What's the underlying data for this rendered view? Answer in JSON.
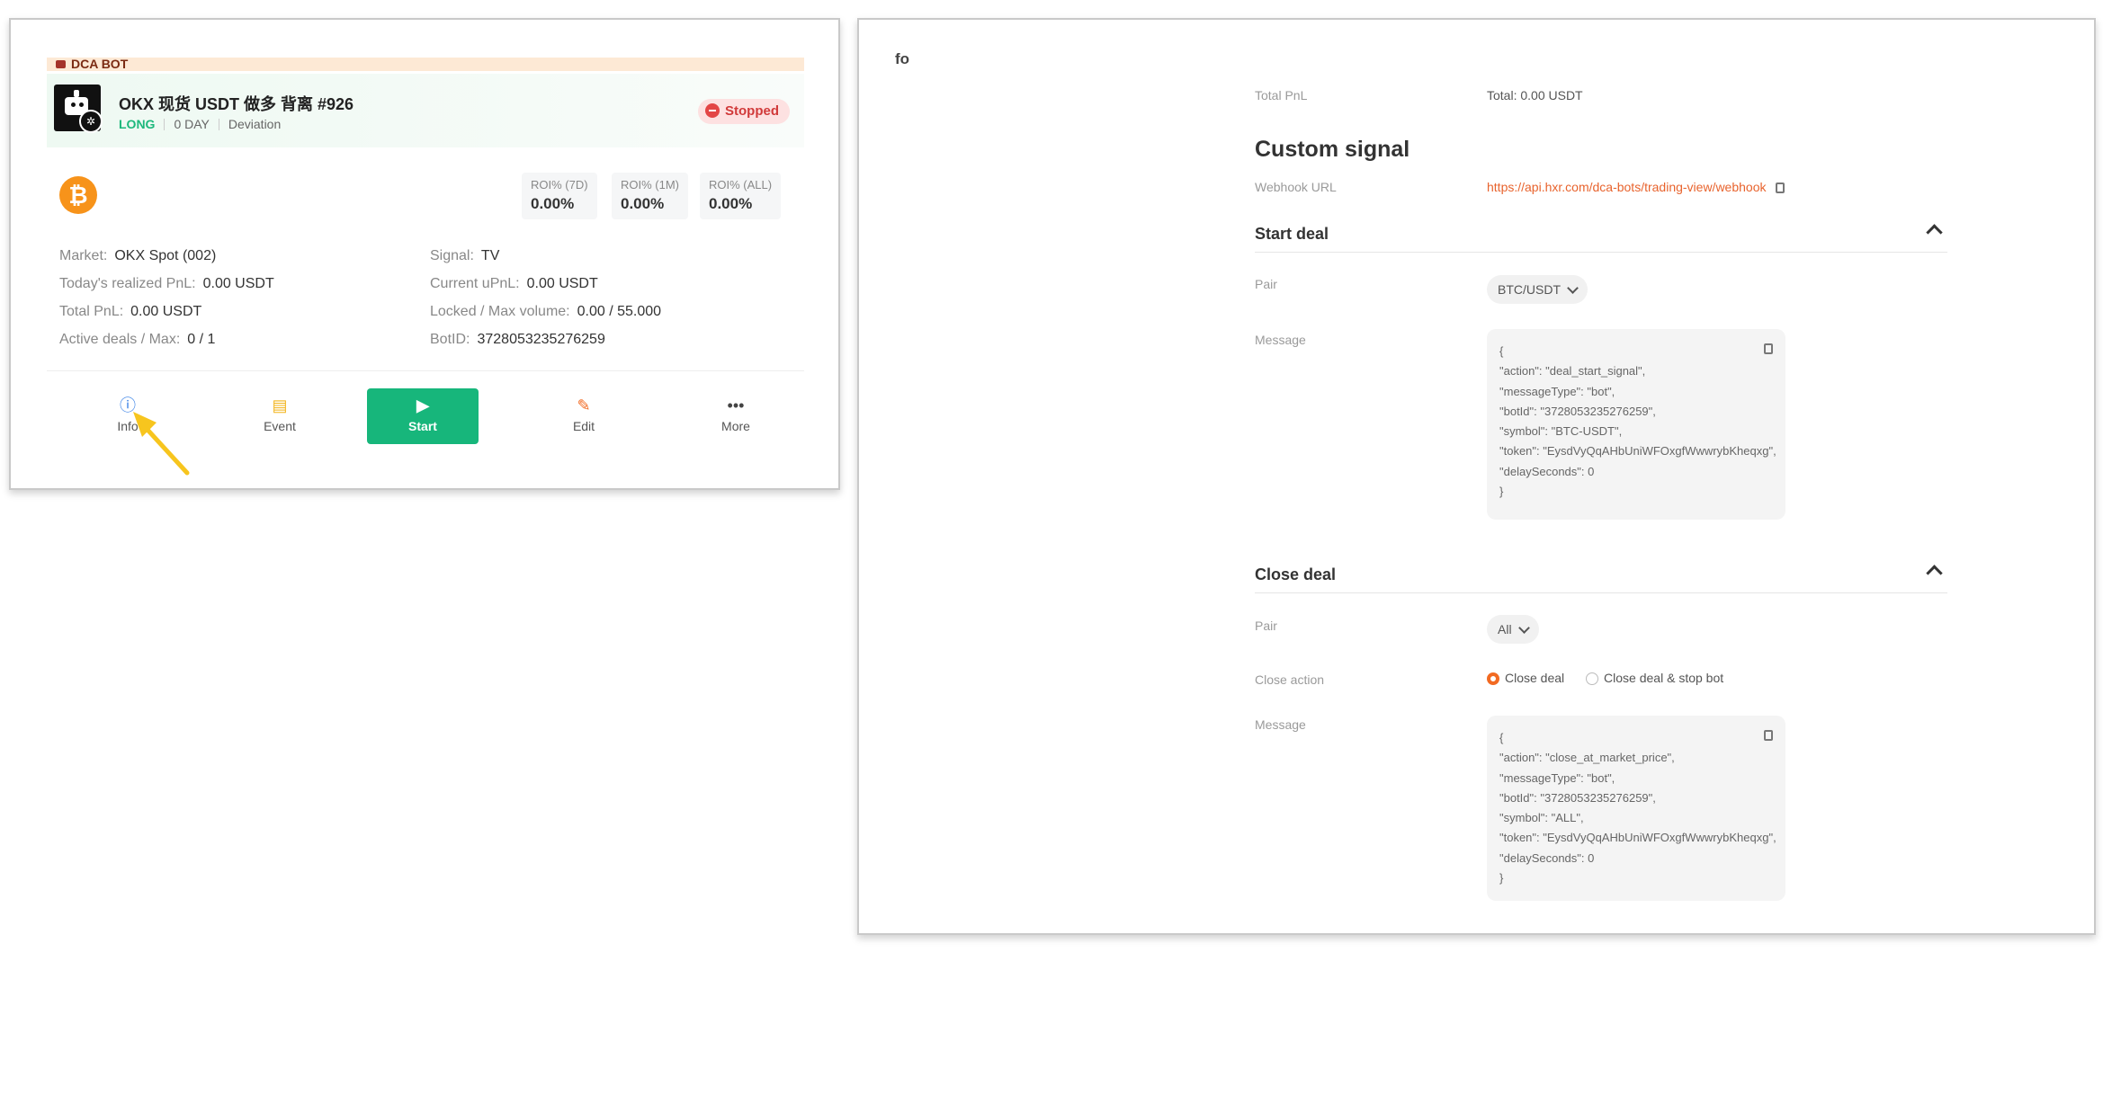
{
  "left": {
    "dca_label": "DCA BOT",
    "bot_name": "OKX 现货 USDT 做多 背离 #926",
    "tags": [
      "LONG",
      "0 DAY",
      "Deviation"
    ],
    "status": "Stopped",
    "coin_symbol": "₿",
    "roi": [
      {
        "label": "ROI% (7D)",
        "value": "0.00%"
      },
      {
        "label": "ROI% (1M)",
        "value": "0.00%"
      },
      {
        "label": "ROI% (ALL)",
        "value": "0.00%"
      }
    ],
    "info_left": [
      {
        "k": "Market:",
        "v": "OKX Spot (002)"
      },
      {
        "k": "Today's realized PnL:",
        "v": "0.00 USDT"
      },
      {
        "k": "Total PnL:",
        "v": "0.00 USDT"
      },
      {
        "k": "Active deals / Max:",
        "v": "0 / 1"
      }
    ],
    "info_right": [
      {
        "k": "Signal:",
        "v": "TV"
      },
      {
        "k": "Current uPnL:",
        "v": "0.00 USDT"
      },
      {
        "k": "Locked / Max volume:",
        "v": "0.00 / 55.000"
      },
      {
        "k": "BotID:",
        "v": "3728053235276259"
      }
    ],
    "actions": {
      "info": "Info",
      "event": "Event",
      "start": "Start",
      "edit": "Edit",
      "more": "More"
    },
    "colors": {
      "accent": "#17b67b",
      "status": "#e34646",
      "coin": "#f7931a"
    }
  },
  "right": {
    "partial_heading": "fo",
    "total_pnl_label": "Total PnL",
    "total_pnl_value": "Total: 0.00 USDT",
    "custom_signal_title": "Custom signal",
    "webhook_label": "Webhook URL",
    "webhook_url": "https://api.hxr.com/dca-bots/trading-view/webhook",
    "start_deal": {
      "title": "Start deal",
      "pair_label": "Pair",
      "pair_value": "BTC/USDT",
      "message_label": "Message",
      "message_lines": [
        "{",
        " \"action\": \"deal_start_signal\",",
        " \"messageType\": \"bot\",",
        " \"botId\": \"3728053235276259\",",
        " \"symbol\": \"BTC-USDT\",",
        " \"token\": \"EysdVyQqAHbUniWFOxgfWwwrybKheqxg\",",
        " \"delaySeconds\": 0",
        "}"
      ]
    },
    "close_deal": {
      "title": "Close deal",
      "pair_label": "Pair",
      "pair_value": "All",
      "close_action_label": "Close action",
      "options": [
        "Close deal",
        "Close deal & stop bot"
      ],
      "selected_option": "Close deal",
      "message_label": "Message",
      "message_lines": [
        "{",
        " \"action\": \"close_at_market_price\",",
        " \"messageType\": \"bot\",",
        " \"botId\": \"3728053235276259\",",
        " \"symbol\": \"ALL\",",
        " \"token\": \"EysdVyQqAHbUniWFOxgfWwwrybKheqxg\",",
        " \"delaySeconds\": 0",
        "}"
      ]
    },
    "colors": {
      "link": "#e8632d",
      "radio_selected": "#f26a22"
    }
  }
}
